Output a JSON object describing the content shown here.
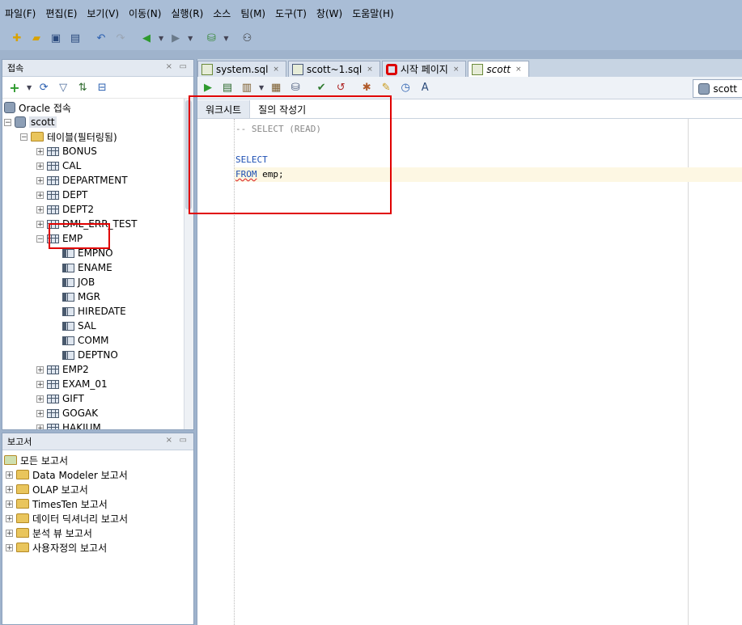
{
  "menu": [
    "파일(F)",
    "편집(E)",
    "보기(V)",
    "이동(N)",
    "실행(R)",
    "소스",
    "팀(M)",
    "도구(T)",
    "창(W)",
    "도움말(H)"
  ],
  "connections_panel": {
    "title": "접속"
  },
  "tree": {
    "root": "Oracle 접속",
    "connection": "scott",
    "tables_folder": "테이블(필터링됨)",
    "tables_before": [
      "BONUS",
      "CAL",
      "DEPARTMENT",
      "DEPT",
      "DEPT2",
      "DML_ERR_TEST"
    ],
    "expanded_table": "EMP",
    "columns": [
      "EMPNO",
      "ENAME",
      "JOB",
      "MGR",
      "HIREDATE",
      "SAL",
      "COMM",
      "DEPTNO"
    ],
    "tables_after": [
      "EMP2",
      "EXAM_01",
      "GIFT",
      "GOGAK",
      "HAKJUM"
    ]
  },
  "reports_panel": {
    "title": "보고서",
    "all_reports": "모든 보고서",
    "items": [
      "Data Modeler 보고서",
      "OLAP 보고서",
      "TimesTen 보고서",
      "데이터 딕셔너리 보고서",
      "분석 뷰 보고서",
      "사용자정의 보고서"
    ]
  },
  "tabs": [
    {
      "label": "system.sql",
      "icon": "sql-icon"
    },
    {
      "label": "scott~1.sql",
      "icon": "sql-file-icon"
    },
    {
      "label": "시작 페이지",
      "icon": "oracle-icon"
    },
    {
      "label": "scott",
      "icon": "sql-icon",
      "active": true
    }
  ],
  "connection_selector": "scott",
  "subtabs": [
    "워크시트",
    "질의 작성기"
  ],
  "code": {
    "comment": "-- SELECT (READ)",
    "line1": "SELECT",
    "line2_kw": "FROM",
    "line2_rest": " emp;"
  }
}
